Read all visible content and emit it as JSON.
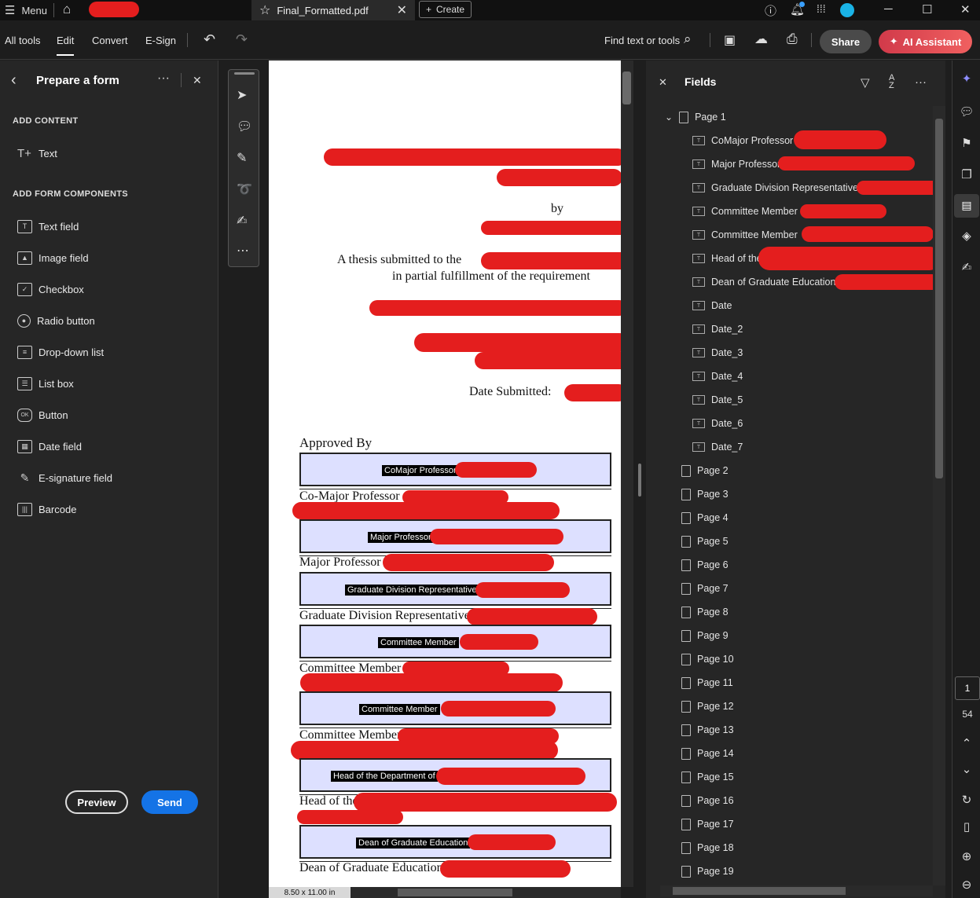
{
  "titlebar": {
    "menu_label": "Menu",
    "tab_title": "Final_Formatted.pdf",
    "create_label": "Create"
  },
  "toolbar": {
    "tabs": [
      "All tools",
      "Edit",
      "Convert",
      "E-Sign"
    ],
    "active_tab": "Edit",
    "find_label": "Find text or tools",
    "share_label": "Share",
    "ai_label": "AI Assistant"
  },
  "left_panel": {
    "title": "Prepare a form",
    "add_content_heading": "ADD CONTENT",
    "content_items": [
      {
        "label": "Text",
        "icon": "text-tool-icon"
      }
    ],
    "add_form_heading": "ADD FORM COMPONENTS",
    "form_items": [
      {
        "label": "Text field",
        "icon": "text-field-icon"
      },
      {
        "label": "Image field",
        "icon": "image-field-icon"
      },
      {
        "label": "Checkbox",
        "icon": "checkbox-icon"
      },
      {
        "label": "Radio button",
        "icon": "radio-button-icon"
      },
      {
        "label": "Drop-down list",
        "icon": "dropdown-list-icon"
      },
      {
        "label": "List box",
        "icon": "list-box-icon"
      },
      {
        "label": "Button",
        "icon": "button-icon"
      },
      {
        "label": "Date field",
        "icon": "date-field-icon"
      },
      {
        "label": "E-signature field",
        "icon": "e-signature-icon"
      },
      {
        "label": "Barcode",
        "icon": "barcode-icon"
      }
    ],
    "preview_label": "Preview",
    "send_label": "Send"
  },
  "document": {
    "by": "by",
    "thesis_line1": "A thesis submitted to the",
    "thesis_line2": "in partial fulfillment of the requirement",
    "date_submitted": "Date Submitted:",
    "approved_by": "Approved By",
    "fields": [
      {
        "label": "CoMajor Professor"
      },
      {
        "label": "Major Professor"
      },
      {
        "label": "Graduate Division Representative"
      },
      {
        "label": "Committee Member"
      },
      {
        "label": "Committee Member"
      },
      {
        "label": "Head of the Department of"
      },
      {
        "label": "Dean of Graduate Education"
      }
    ],
    "captions": [
      "Co-Major Professor –",
      "Major Professor -",
      "Graduate Division Representative -",
      "Committee Member –",
      "Committee Member –",
      "Head of the",
      "Dean of Graduate Education -"
    ],
    "page_size": "8.50 x 11.00 in"
  },
  "fields_panel": {
    "title": "Fields",
    "page1_label": "Page 1",
    "page1_fields": [
      "CoMajor Professor",
      "Major Professor",
      "Graduate Division Representative",
      "Committee Member",
      "Committee Member",
      "Head of the",
      "Dean of Graduate Education",
      "Date",
      "Date_2",
      "Date_3",
      "Date_4",
      "Date_5",
      "Date_6",
      "Date_7"
    ],
    "other_pages": [
      "Page 2",
      "Page 3",
      "Page 4",
      "Page 5",
      "Page 6",
      "Page 7",
      "Page 8",
      "Page 9",
      "Page 10",
      "Page 11",
      "Page 12",
      "Page 13",
      "Page 14",
      "Page 15",
      "Page 16",
      "Page 17",
      "Page 18",
      "Page 19"
    ]
  },
  "navigation": {
    "current_page": "1",
    "total_pages": "54"
  },
  "colors": {
    "accent_blue": "#1473e6",
    "redaction_red": "#e41e1e",
    "form_field_fill": "#dde0ff"
  }
}
